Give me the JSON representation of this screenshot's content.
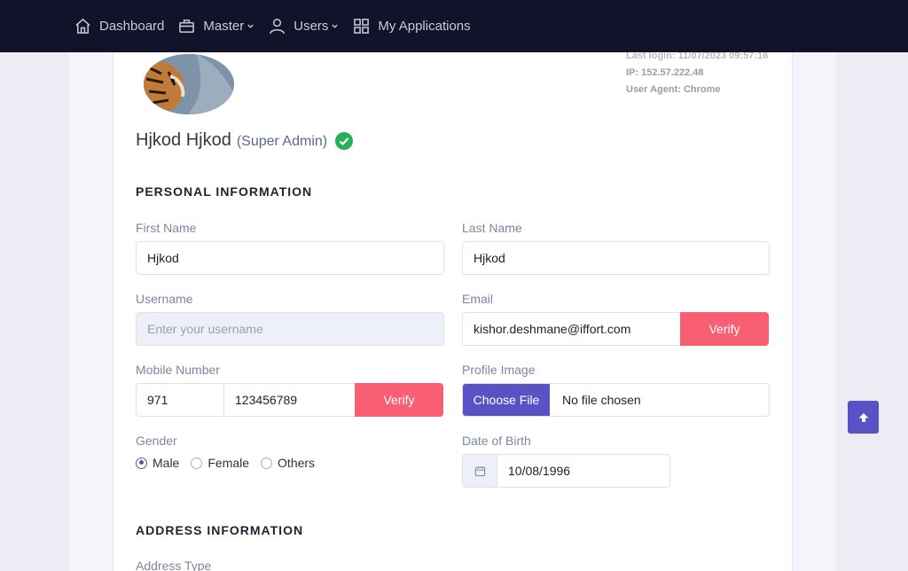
{
  "nav": {
    "items": [
      {
        "label": "Dashboard",
        "icon": "home-icon"
      },
      {
        "label": "Master",
        "icon": "briefcase-icon"
      },
      {
        "label": "Users",
        "icon": "user-icon"
      },
      {
        "label": "My Applications",
        "icon": "grid-icon"
      }
    ]
  },
  "session": {
    "last_login": "Last login: 11/07/2023 09:57:16",
    "ip": "IP: 152.57.222.48",
    "user_agent": "User Agent: Chrome"
  },
  "profile": {
    "name": "Hjkod Hjkod",
    "role": "(Super Admin)"
  },
  "personal": {
    "title": "PERSONAL INFORMATION",
    "first_name_label": "First Name",
    "first_name_value": "Hjkod",
    "last_name_label": "Last Name",
    "last_name_value": "Hjkod",
    "username_label": "Username",
    "username_placeholder": "Enter your username",
    "email_label": "Email",
    "email_value": "kishor.deshmane@iffort.com",
    "email_verify": "Verify",
    "mobile_label": "Mobile Number",
    "mobile_code": "971",
    "mobile_number": "123456789",
    "mobile_verify": "Verify",
    "profile_image_label": "Profile Image",
    "choose_file": "Choose File",
    "no_file": "No file chosen",
    "gender_label": "Gender",
    "gender_options": [
      "Male",
      "Female",
      "Others"
    ],
    "gender_selected": "Male",
    "dob_label": "Date of Birth",
    "dob_value": "10/08/1996"
  },
  "address": {
    "title": "ADDRESS INFORMATION",
    "type_label": "Address Type"
  },
  "colors": {
    "topbar": "#12122a",
    "accent": "#5a52c4",
    "verify": "#f85f73",
    "verified_badge": "#22b05a"
  }
}
